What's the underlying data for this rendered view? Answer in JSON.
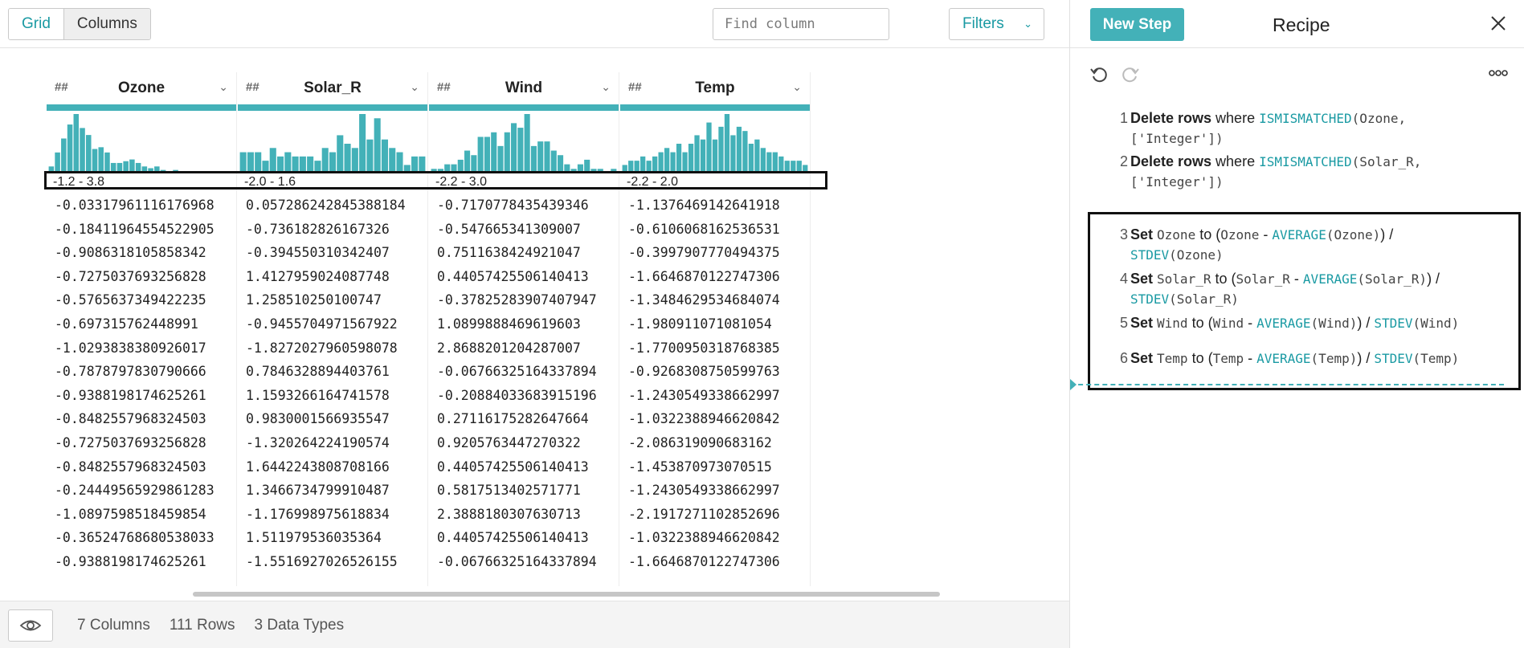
{
  "toolbar": {
    "grid_label": "Grid",
    "columns_label": "Columns",
    "find_placeholder": "Find column",
    "filters_label": "Filters"
  },
  "colors": {
    "accent": "#43b1b8",
    "accent_text": "#1a9aa3"
  },
  "columns": [
    {
      "type": "##",
      "name": "Ozone",
      "range": "-1.2 - 3.8",
      "histogram": [
        4,
        12,
        20,
        28,
        34,
        26,
        22,
        14,
        15,
        12,
        6,
        6,
        7,
        8,
        6,
        4,
        3,
        4,
        2,
        1,
        2,
        1,
        0,
        1,
        1,
        0,
        0,
        0,
        1,
        0
      ],
      "values": [
        "-0.03317961116176968",
        "-0.18411964554522905",
        "-0.9086318105858342",
        "-0.7275037693256828",
        "-0.5765637349422235",
        "-0.697315762448991",
        "-1.0293838380926017",
        "-0.7878797830790666",
        "-0.9388198174625261",
        "-0.8482557968324503",
        "-0.7275037693256828",
        "-0.8482557968324503",
        "-0.24449565929861283",
        "-1.0897598518459854",
        "-0.36524768680538033",
        "-0.9388198174625261"
      ]
    },
    {
      "type": "##",
      "name": "Solar_R",
      "range": "-2.0 - 1.6",
      "histogram": [
        10,
        10,
        10,
        6,
        12,
        8,
        10,
        8,
        8,
        8,
        6,
        12,
        10,
        18,
        14,
        12,
        28,
        16,
        26,
        16,
        12,
        10,
        4,
        8,
        8
      ],
      "values": [
        "0.057286242845388184",
        "-0.736182826167326",
        "-0.394550310342407⁠",
        "1.4127959024087748",
        "1.258510250100747",
        "-0.9455704971567922",
        "-1.8272027960598078",
        "0.7846328894403761",
        "1.1593266164741578",
        "0.9830001566935547",
        "-1.320264224190574",
        "1.6442243808708166",
        "1.3466734799910487",
        "-1.176998975618834",
        "1.511979536035364",
        "-1.5516927026526155"
      ]
    },
    {
      "type": "##",
      "name": "Wind",
      "range": "-2.2 - 3.0",
      "histogram": [
        2,
        2,
        4,
        4,
        6,
        10,
        8,
        16,
        16,
        18,
        12,
        18,
        22,
        20,
        26,
        12,
        14,
        14,
        10,
        8,
        4,
        2,
        4,
        6,
        2,
        2,
        0,
        2
      ],
      "values": [
        "-0.7170778435439346",
        "-0.547665341309007",
        "0.7511638424921047",
        "0.44057425506140413",
        "-0.37825283907407947",
        "1.0899888469619603",
        "2.8688201204287007",
        "-0.06766325164337894",
        "-0.20884033683915196",
        "0.27116175282647664",
        "0.9205763447270322",
        "0.44057425506140413",
        "0.5817513402571771",
        "2.3888180307630713",
        "0.44057425506140413",
        "-0.06766325164337894"
      ]
    },
    {
      "type": "##",
      "name": "Temp",
      "range": "-2.2 - 2.0",
      "histogram": [
        4,
        6,
        6,
        8,
        6,
        8,
        10,
        12,
        10,
        14,
        10,
        14,
        18,
        16,
        24,
        16,
        22,
        28,
        18,
        22,
        20,
        14,
        16,
        12,
        10,
        10,
        8,
        6,
        6,
        6,
        4
      ],
      "values": [
        "-1.1376469142641918",
        "-0.6106068162536531",
        "-0.3997907770494375",
        "-1.6646870122747306",
        "-1.3484629534684074",
        "-1.980911071081054",
        "-1.7700950318768385",
        "-0.9268308750599763",
        "-1.2430549338662997",
        "-1.0322388946620842",
        "-2.086319090683162",
        "-1.453870973070515",
        "-1.2430549338662997",
        "-2.1917271102852696",
        "-1.0322388946620842",
        "-1.6646870122747306"
      ]
    }
  ],
  "footer": {
    "columns": "7 Columns",
    "rows": "111 Rows",
    "types": "3 Data Types"
  },
  "recipe": {
    "new_step_label": "New Step",
    "title": "Recipe",
    "steps": [
      {
        "num": "1",
        "verb": "Delete rows",
        "t1": " where ",
        "fn1": "ISMISMATCHED",
        "m1": "(Ozone,",
        "line2": "['Integer'])"
      },
      {
        "num": "2",
        "verb": "Delete rows",
        "t1": " where ",
        "fn1": "ISMISMATCHED",
        "m1": "(Solar_R,",
        "line2": "['Integer'])"
      },
      {
        "num": "3",
        "verb": "Set",
        "col": "Ozone",
        "t1": " to ",
        "p1": "(",
        "c2": "Ozone",
        "minus": " - ",
        "fn": "AVERAGE",
        "arg": "(Ozone)",
        "close": ") /",
        "fn2": "STDEV",
        "arg2": "(Ozone)"
      },
      {
        "num": "4",
        "verb": "Set",
        "col": "Solar_R",
        "t1": " to ",
        "p1": "(",
        "c2": "Solar_R",
        "minus": " - ",
        "fn": "AVERAGE",
        "arg": "(Solar_R)",
        "close": ") /",
        "fn2": "STDEV",
        "arg2": "(Solar_R)"
      },
      {
        "num": "5",
        "verb": "Set",
        "col": "Wind",
        "t1": " to ",
        "p1": "(",
        "c2": "Wind",
        "minus": " - ",
        "fn": "AVERAGE",
        "arg": "(Wind)",
        "close": ") / ",
        "fn2": "STDEV",
        "arg2": "(Wind)"
      },
      {
        "num": "6",
        "verb": "Set",
        "col": "Temp",
        "t1": " to ",
        "p1": "(",
        "c2": "Temp",
        "minus": " - ",
        "fn": "AVERAGE",
        "arg": "(Temp)",
        "close": ") / ",
        "fn2": "STDEV",
        "arg2": "(Temp)"
      }
    ]
  }
}
